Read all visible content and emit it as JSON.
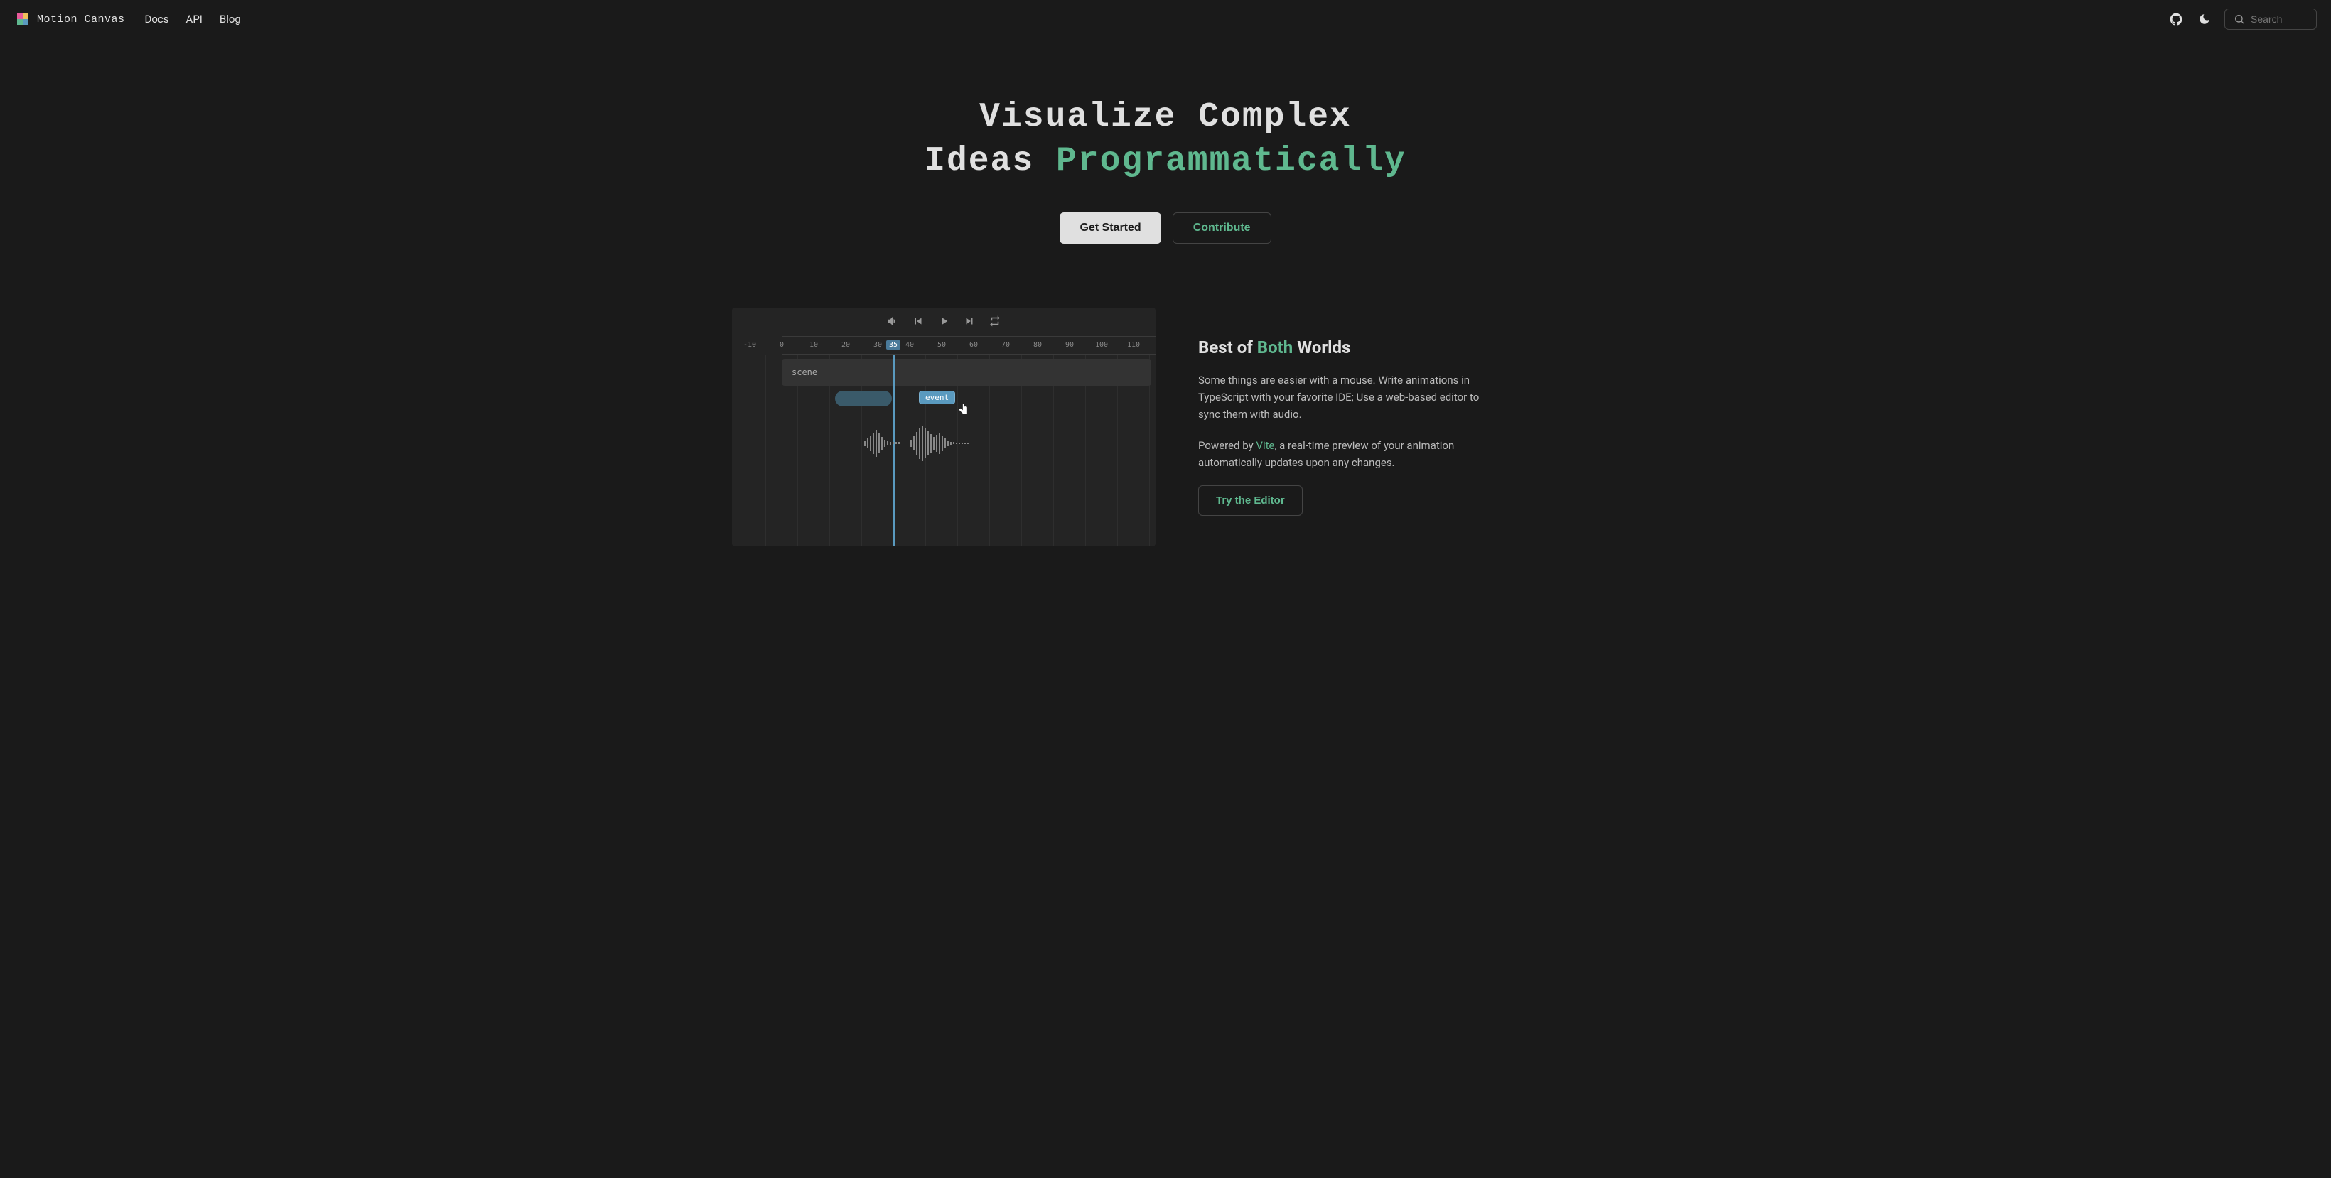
{
  "brand": "Motion Canvas",
  "nav": {
    "docs": "Docs",
    "api": "API",
    "blog": "Blog"
  },
  "search": {
    "placeholder": "Search"
  },
  "hero": {
    "line1a": "Visualize Complex",
    "line2a": "Ideas ",
    "line2b": "Programmatically",
    "btn_primary": "Get Started",
    "btn_secondary": "Contribute"
  },
  "editor": {
    "ruler": [
      "-10",
      "0",
      "10",
      "20",
      "30",
      "40",
      "50",
      "60",
      "70",
      "80",
      "90",
      "100",
      "110"
    ],
    "ruler_highlight": "35",
    "scene_label": "scene",
    "event_label": "event"
  },
  "feature": {
    "title_a": "Best of ",
    "title_b": "Both",
    "title_c": " Worlds",
    "para1": "Some things are easier with a mouse. Write animations in TypeScript with your favorite IDE; Use a web-based editor to sync them with audio.",
    "para2a": "Powered by ",
    "para2_link": "Vite",
    "para2b": ", a real-time preview of your animation automatically updates upon any changes.",
    "btn": "Try the Editor"
  }
}
